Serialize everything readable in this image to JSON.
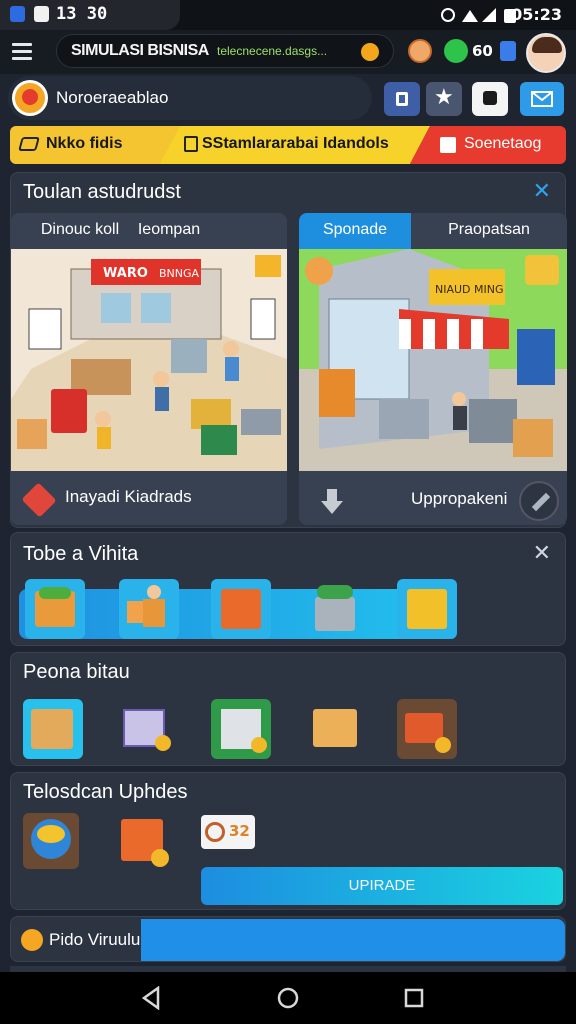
{
  "status_bar": {
    "time_left": "13 30",
    "time_right": "05:23"
  },
  "header": {
    "title": "SIMULASI BISNISA",
    "subtitle": "telecnecene.dasgs...",
    "count_label": "60"
  },
  "profile": {
    "name": "Noroeraeablao"
  },
  "ribbon": [
    {
      "label": "Nkko fidis",
      "color": "#f5c431"
    },
    {
      "label": "SStamlararabai Idandols",
      "color": "#f7d22b"
    },
    {
      "label": "Soenetaog",
      "color": "#e63b2e"
    }
  ],
  "panel1": {
    "title": "Toulan astudrudst",
    "left_card": {
      "tab_a": "Dinouc koll",
      "tab_b": "Ieompan",
      "footer": "Inayadi Kiadrads",
      "sign": "WARO",
      "sign2": "BNNGA"
    },
    "right_card": {
      "tab_a": "Sponade",
      "tab_b": "Praopatsan",
      "footer": "Uppropakeni",
      "sign": "NIAUD MING"
    }
  },
  "panel2": {
    "title": "Tobe a Vihita"
  },
  "panel3": {
    "title": "Peona bitau"
  },
  "panel4": {
    "title": "Telosdcan Uphdes",
    "badge": "32",
    "upgrade_label": "UPIRADE"
  },
  "panel5": {
    "title": "Pido Viruulu"
  },
  "colors": {
    "accent_blue": "#1e9be6",
    "accent_cyan": "#1ad3e0",
    "panel": "#2d3441"
  }
}
